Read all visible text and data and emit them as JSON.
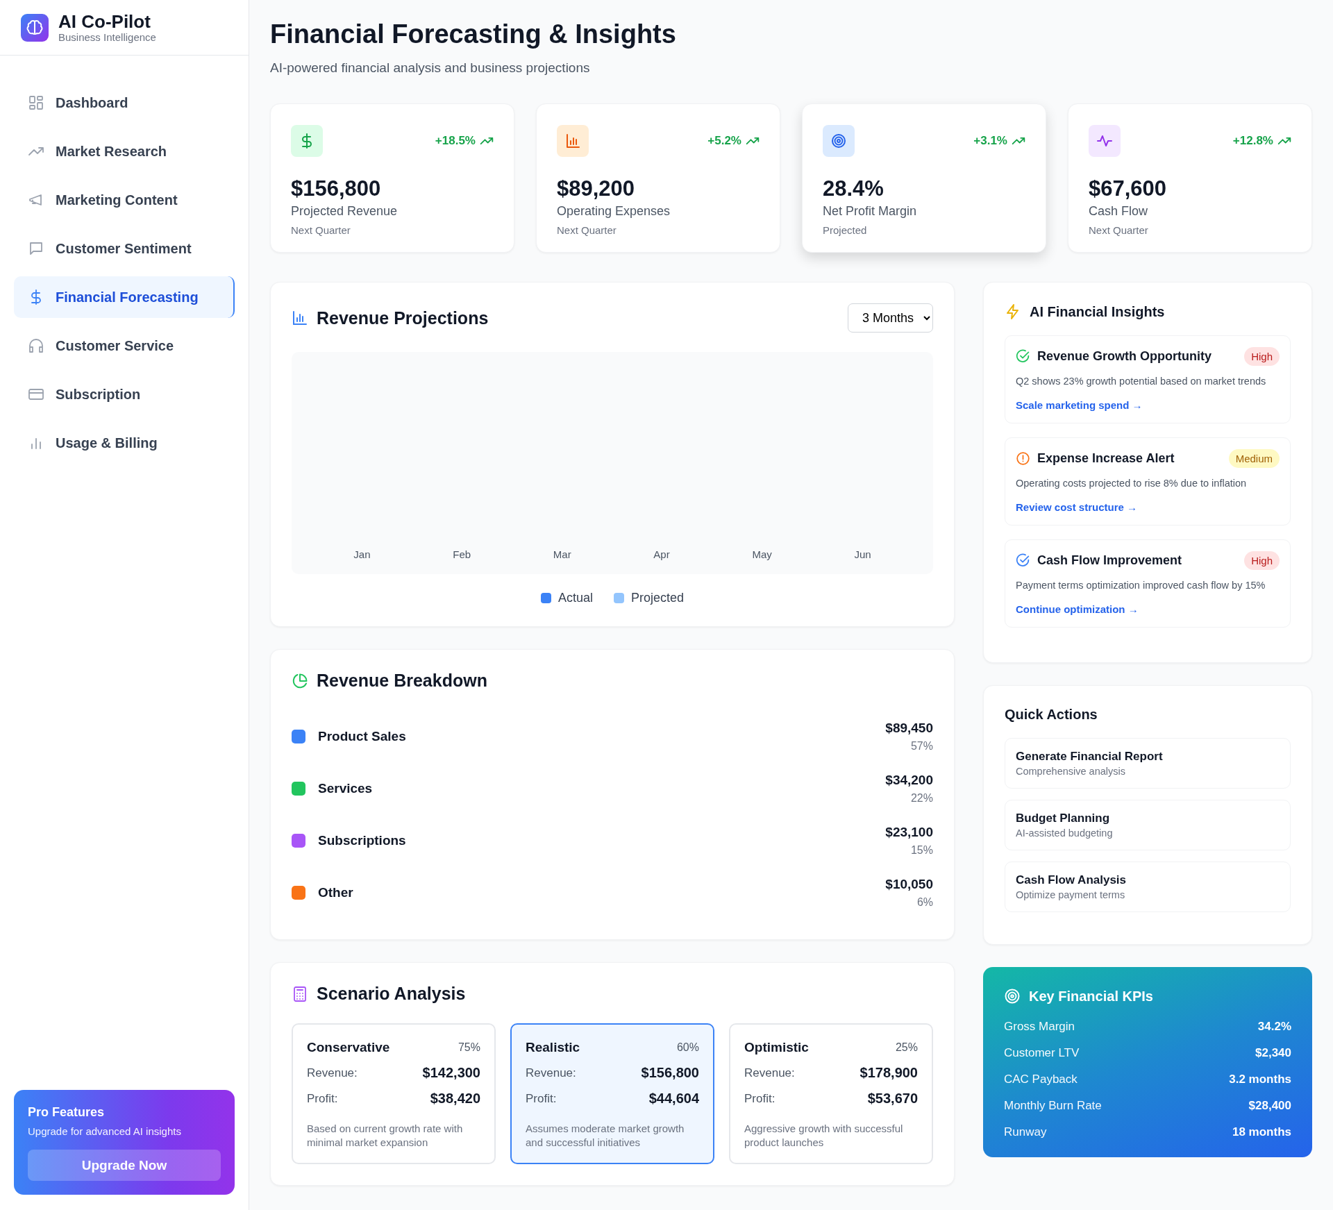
{
  "brand": {
    "name": "AI Co-Pilot",
    "tagline": "Business Intelligence"
  },
  "nav": [
    {
      "label": "Dashboard",
      "selected": false
    },
    {
      "label": "Market Research",
      "selected": false
    },
    {
      "label": "Marketing Content",
      "selected": false
    },
    {
      "label": "Customer Sentiment",
      "selected": false
    },
    {
      "label": "Financial Forecasting",
      "selected": true
    },
    {
      "label": "Customer Service",
      "selected": false
    },
    {
      "label": "Subscription",
      "selected": false
    },
    {
      "label": "Usage & Billing",
      "selected": false
    }
  ],
  "promo": {
    "title": "Pro Features",
    "text": "Upgrade for advanced AI insights",
    "button": "Upgrade Now"
  },
  "page": {
    "title": "Financial Forecasting & Insights",
    "subtitle": "AI-powered financial analysis and business projections"
  },
  "metrics": [
    {
      "change": "+18.5%",
      "value": "$156,800",
      "label": "Projected Revenue",
      "period": "Next Quarter",
      "elevated": false
    },
    {
      "change": "+5.2%",
      "value": "$89,200",
      "label": "Operating Expenses",
      "period": "Next Quarter",
      "elevated": false
    },
    {
      "change": "+3.1%",
      "value": "28.4%",
      "label": "Net Profit Margin",
      "period": "Projected",
      "elevated": true
    },
    {
      "change": "+12.8%",
      "value": "$67,600",
      "label": "Cash Flow",
      "period": "Next Quarter",
      "elevated": false
    }
  ],
  "projections": {
    "title": "Revenue Projections",
    "range": "3 Months",
    "months": [
      "Jan",
      "Feb",
      "Mar",
      "Apr",
      "May",
      "Jun"
    ],
    "legend": [
      {
        "label": "Actual",
        "color": "#3b82f6"
      },
      {
        "label": "Projected",
        "color": "#93c5fd"
      }
    ]
  },
  "breakdown": {
    "title": "Revenue Breakdown",
    "items": [
      {
        "label": "Product Sales",
        "amount": "$89,450",
        "share": "57%",
        "color": "#3b82f6"
      },
      {
        "label": "Services",
        "amount": "$34,200",
        "share": "22%",
        "color": "#22c55e"
      },
      {
        "label": "Subscriptions",
        "amount": "$23,100",
        "share": "15%",
        "color": "#a855f7"
      },
      {
        "label": "Other",
        "amount": "$10,050",
        "share": "6%",
        "color": "#f97316"
      }
    ]
  },
  "scenarios": {
    "title": "Scenario Analysis",
    "items": [
      {
        "name": "Conservative",
        "probability": "75%",
        "revenue_label": "Revenue:",
        "revenue": "$142,300",
        "profit_label": "Profit:",
        "profit": "$38,420",
        "note": "Based on current growth rate with minimal market expansion",
        "selected": false
      },
      {
        "name": "Realistic",
        "probability": "60%",
        "revenue_label": "Revenue:",
        "revenue": "$156,800",
        "profit_label": "Profit:",
        "profit": "$44,604",
        "note": "Assumes moderate market growth and successful initiatives",
        "selected": true
      },
      {
        "name": "Optimistic",
        "probability": "25%",
        "revenue_label": "Revenue:",
        "revenue": "$178,900",
        "profit_label": "Profit:",
        "profit": "$53,670",
        "note": "Aggressive growth with successful product launches",
        "selected": false
      }
    ]
  },
  "insights": {
    "title": "AI Financial Insights",
    "items": [
      {
        "kind": "check",
        "color": "#22c55e",
        "title": "Revenue Growth Opportunity",
        "priority": "High",
        "text": "Q2 shows 23% growth potential based on market trends",
        "action": "Scale marketing spend →"
      },
      {
        "kind": "alert",
        "color": "#f97316",
        "title": "Expense Increase Alert",
        "priority": "Medium",
        "text": "Operating costs projected to rise 8% due to inflation",
        "action": "Review cost structure →"
      },
      {
        "kind": "check",
        "color": "#3b82f6",
        "title": "Cash Flow Improvement",
        "priority": "High",
        "text": "Payment terms optimization improved cash flow by 15%",
        "action": "Continue optimization →"
      }
    ]
  },
  "quick_actions": {
    "title": "Quick Actions",
    "items": [
      {
        "title": "Generate Financial Report",
        "subtitle": "Comprehensive analysis"
      },
      {
        "title": "Budget Planning",
        "subtitle": "AI-assisted budgeting"
      },
      {
        "title": "Cash Flow Analysis",
        "subtitle": "Optimize payment terms"
      }
    ]
  },
  "kpis": {
    "title": "Key Financial KPIs",
    "items": [
      {
        "label": "Gross Margin",
        "value": "34.2%"
      },
      {
        "label": "Customer LTV",
        "value": "$2,340"
      },
      {
        "label": "CAC Payback",
        "value": "3.2 months"
      },
      {
        "label": "Monthly Burn Rate",
        "value": "$28,400"
      },
      {
        "label": "Runway",
        "value": "18 months"
      }
    ]
  }
}
